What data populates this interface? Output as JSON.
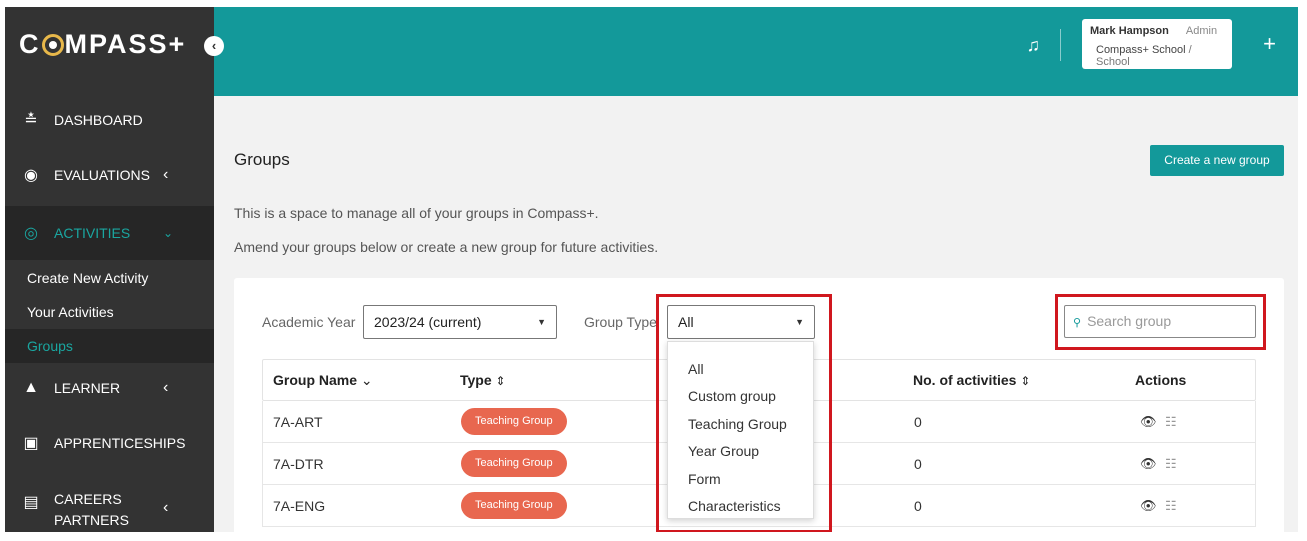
{
  "app": {
    "logo_left": "C",
    "logo_right": "MPASS+",
    "collapse_icon": "chevron-left-icon"
  },
  "sidebar": {
    "items": [
      {
        "label": "DASHBOARD",
        "icon": "chart-icon"
      },
      {
        "label": "EVALUATIONS",
        "icon": "compass-icon"
      },
      {
        "label": "ACTIVITIES",
        "icon": "target-icon"
      },
      {
        "label": "LEARNER",
        "icon": "graduation-cap-icon"
      },
      {
        "label": "APPRENTICESHIPS",
        "icon": "briefcase-search-icon"
      },
      {
        "label": "CAREERS",
        "label2": "PARTNERS",
        "icon": "contact-card-icon"
      }
    ],
    "activities_sub": [
      "Create New Activity",
      "Your Activities",
      "Groups"
    ]
  },
  "header": {
    "user_name": "Mark Hampson",
    "user_role": "Admin",
    "school": "Compass+ School",
    "school_type": "/ School",
    "plus_label": "+"
  },
  "main": {
    "title": "Groups",
    "create_button": "Create a new group",
    "desc1": "This is a space to manage all of your groups in Compass+.",
    "desc2": "Amend your groups below or create a new group for future activities."
  },
  "filters": {
    "academic_year_label": "Academic Year",
    "academic_year_value": "2023/24 (current)",
    "group_type_label": "Group Type",
    "group_type_value": "All",
    "search_placeholder": "Search group"
  },
  "dropdown_options": [
    "All",
    "Custom group",
    "Teaching Group",
    "Year Group",
    "Form",
    "Characteristics"
  ],
  "table": {
    "headers": [
      "Group Name",
      "Type",
      "No. of activities",
      "Actions"
    ],
    "rows": [
      {
        "name": "7A-ART",
        "type": "Teaching Group",
        "activities": "0"
      },
      {
        "name": "7A-DTR",
        "type": "Teaching Group",
        "activities": "0"
      },
      {
        "name": "7A-ENG",
        "type": "Teaching Group",
        "activities": "0"
      }
    ]
  },
  "colors": {
    "teal": "#13999a",
    "sidebar": "#333333",
    "badge": "#e8674f",
    "highlight": "#d0171e"
  }
}
